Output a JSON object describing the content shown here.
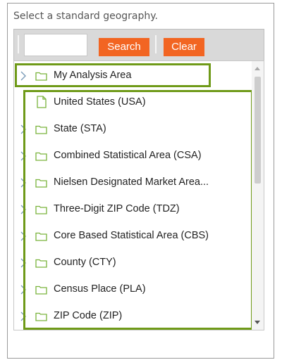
{
  "prompt": "Select a standard geography.",
  "search": {
    "value": "",
    "placeholder": "",
    "search_label": "Search",
    "clear_label": "Clear"
  },
  "tree": {
    "items": [
      {
        "label": "My Analysis Area",
        "icon": "folder-icon",
        "expandable": true
      },
      {
        "label": "United States (USA)",
        "icon": "file-icon",
        "expandable": false
      },
      {
        "label": "State (STA)",
        "icon": "folder-icon",
        "expandable": true
      },
      {
        "label": "Combined Statistical Area (CSA)",
        "icon": "folder-icon",
        "expandable": true
      },
      {
        "label": "Nielsen Designated Market Area...",
        "icon": "folder-icon",
        "expandable": true
      },
      {
        "label": "Three-Digit ZIP Code (TDZ)",
        "icon": "folder-icon",
        "expandable": true
      },
      {
        "label": "Core Based Statistical Area (CBS)",
        "icon": "folder-icon",
        "expandable": true
      },
      {
        "label": "County (CTY)",
        "icon": "folder-icon",
        "expandable": true
      },
      {
        "label": "Census Place (PLA)",
        "icon": "folder-icon",
        "expandable": true
      },
      {
        "label": "ZIP Code (ZIP)",
        "icon": "folder-icon",
        "expandable": true
      }
    ]
  },
  "colors": {
    "accent": "#f26522",
    "highlight": "#6f9a18",
    "icon_green": "#7ab33c"
  }
}
